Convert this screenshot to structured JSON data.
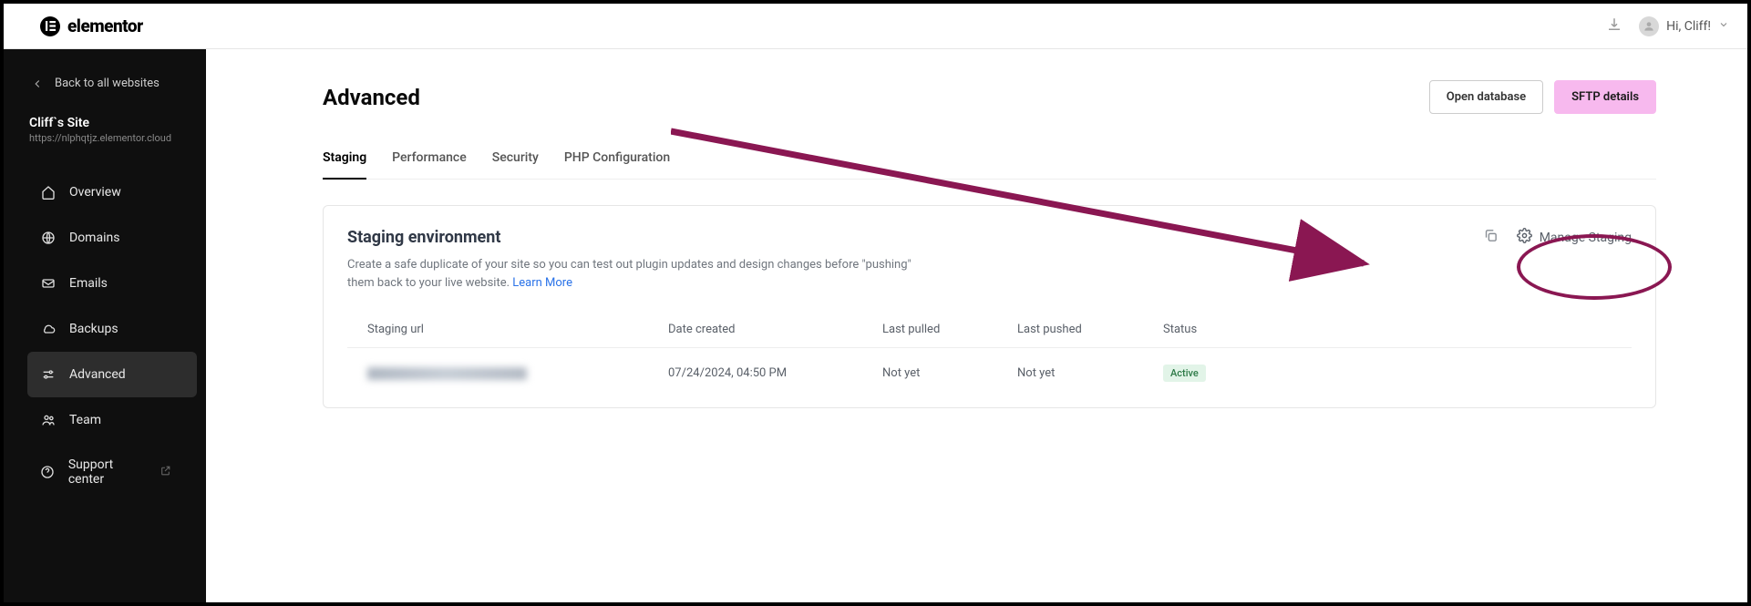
{
  "brand": {
    "name": "elementor"
  },
  "user": {
    "greeting": "Hi, Cliff!"
  },
  "sidebar": {
    "back_label": "Back to all websites",
    "site_name": "Cliff`s Site",
    "site_url": "https://nlphqtjz.elementor.cloud",
    "items": [
      {
        "label": "Overview"
      },
      {
        "label": "Domains"
      },
      {
        "label": "Emails"
      },
      {
        "label": "Backups"
      },
      {
        "label": "Advanced"
      },
      {
        "label": "Team"
      },
      {
        "label": "Support center"
      }
    ]
  },
  "page": {
    "title": "Advanced"
  },
  "header_buttons": {
    "open_db": "Open database",
    "sftp": "SFTP details"
  },
  "tabs": [
    {
      "label": "Staging",
      "active": true
    },
    {
      "label": "Performance",
      "active": false
    },
    {
      "label": "Security",
      "active": false
    },
    {
      "label": "PHP Configuration",
      "active": false
    }
  ],
  "staging_card": {
    "title": "Staging environment",
    "description": "Create a safe duplicate of your site so you can test out plugin updates and design changes before \"pushing\" them back to your live website. ",
    "learn_more": "Learn More",
    "manage_label": "Manage Staging",
    "columns": {
      "url": "Staging url",
      "date": "Date created",
      "pulled": "Last pulled",
      "pushed": "Last pushed",
      "status": "Status"
    },
    "row": {
      "date": "07/24/2024, 04:50 PM",
      "pulled": "Not yet",
      "pushed": "Not yet",
      "status": "Active"
    }
  }
}
